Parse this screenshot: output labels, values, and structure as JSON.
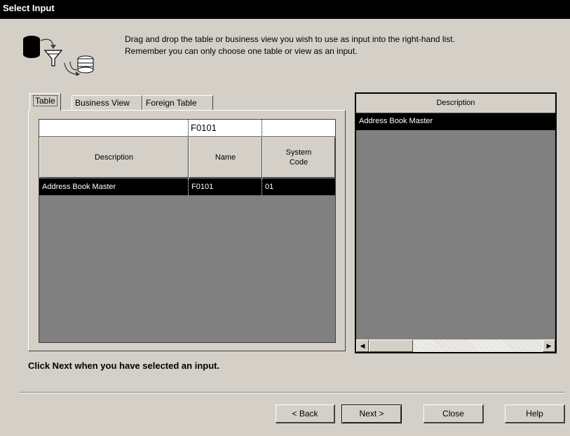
{
  "window": {
    "title": "Select Input"
  },
  "header": {
    "line1": "Drag and drop the table or business view you wish to use as input into the right-hand list.",
    "line2": "Remember you can only choose one table or view as an input.",
    "icon": "database-filter-icon"
  },
  "tabs": [
    {
      "label": "Table",
      "active": true
    },
    {
      "label": "Business View",
      "active": false
    },
    {
      "label": "Foreign Table",
      "active": false
    }
  ],
  "grid": {
    "qbe": [
      "",
      "F0101",
      ""
    ],
    "columns": [
      "Description",
      "Name",
      "System\nCode"
    ],
    "rows": [
      {
        "description": "Address Book Master",
        "name": "F0101",
        "system_code": "01"
      }
    ]
  },
  "selected_list": {
    "header": "Description",
    "rows": [
      "Address Book Master"
    ]
  },
  "instruction": "Click Next when you have selected an input.",
  "buttons": {
    "back": "< Back",
    "next": "Next >",
    "close": "Close",
    "help": "Help"
  },
  "colors": {
    "title_bar": "#000000",
    "dialog": "#d4d0c8",
    "grid_bg": "#808080",
    "selection": "#000000"
  }
}
